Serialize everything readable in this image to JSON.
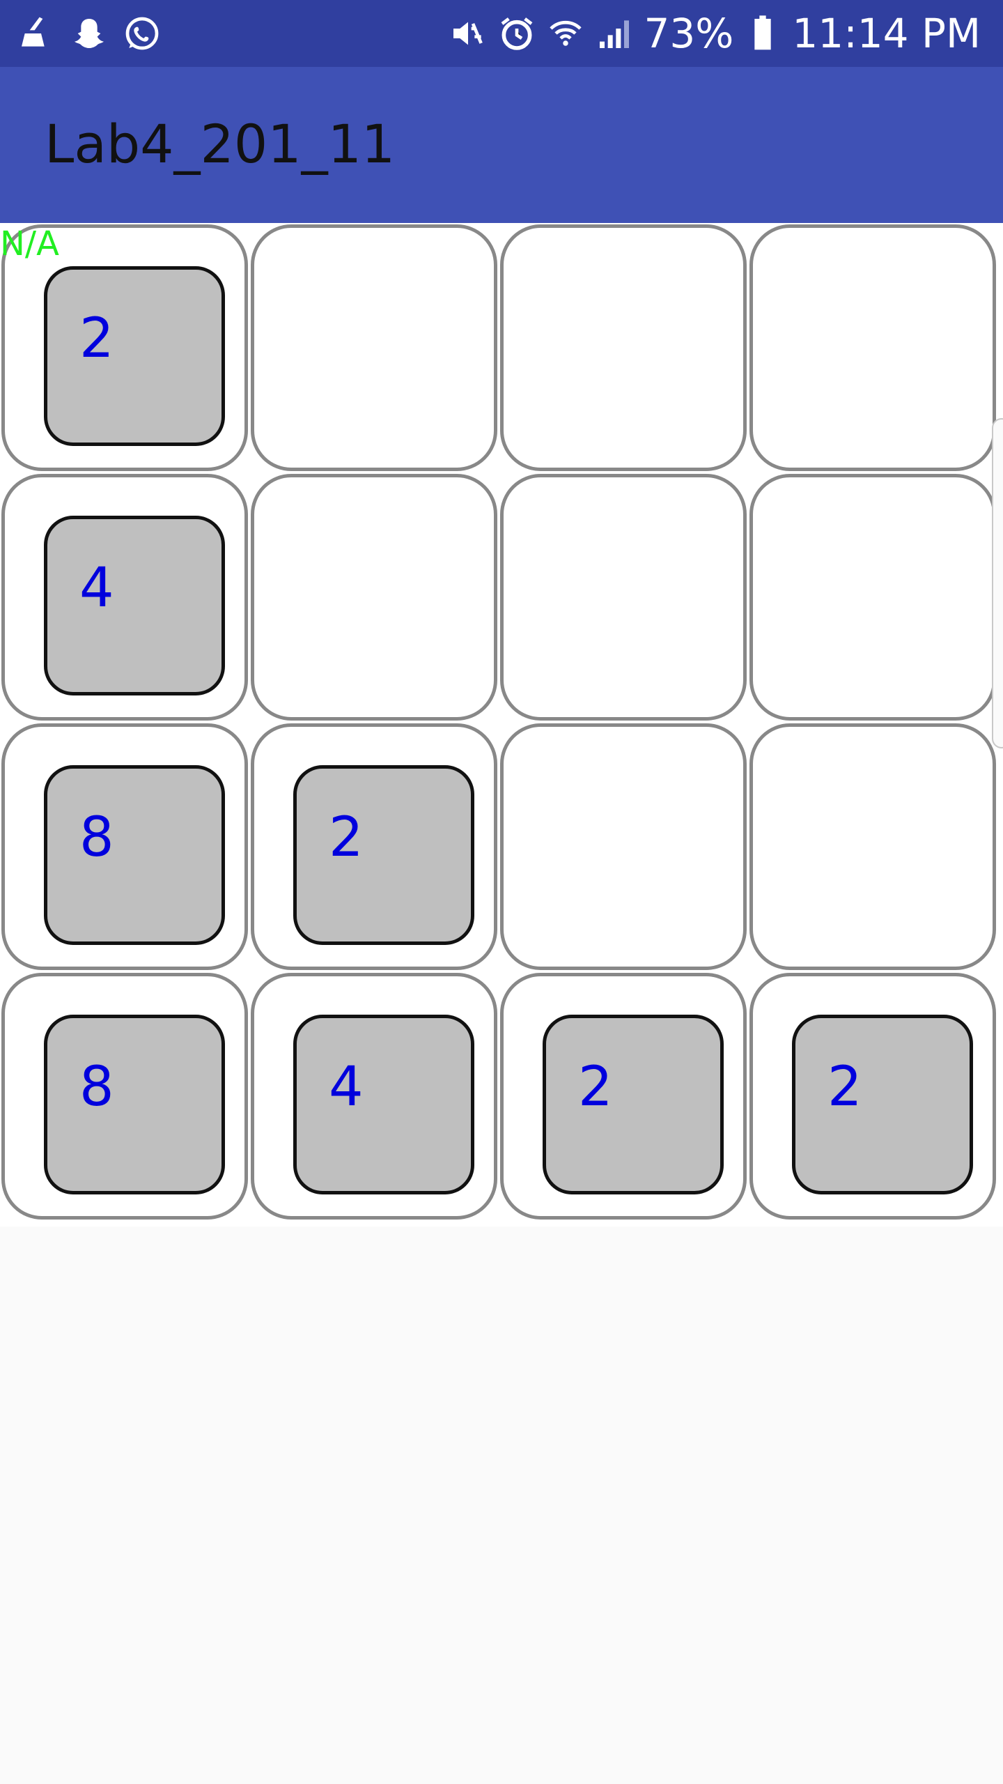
{
  "status_bar": {
    "left_icons": [
      "broom-icon",
      "snapchat-icon",
      "whatsapp-icon"
    ],
    "right_icons": [
      "mute-vibrate-icon",
      "alarm-icon",
      "wifi-icon",
      "signal-icon"
    ],
    "battery": "73%",
    "time": "11:14 PM",
    "background_color": "#303f9f"
  },
  "app_bar": {
    "title": "Lab4_201_11",
    "background_color": "#3f51b5"
  },
  "game": {
    "status": "N/A",
    "rows": [
      [
        "2",
        "",
        "",
        ""
      ],
      [
        "4",
        "",
        "",
        ""
      ],
      [
        "8",
        "2",
        "",
        ""
      ],
      [
        "8",
        "4",
        "2",
        "2"
      ]
    ],
    "tile_color": "#bfbfbf",
    "tile_text_color": "#0000dd",
    "status_color": "#22ee22"
  }
}
